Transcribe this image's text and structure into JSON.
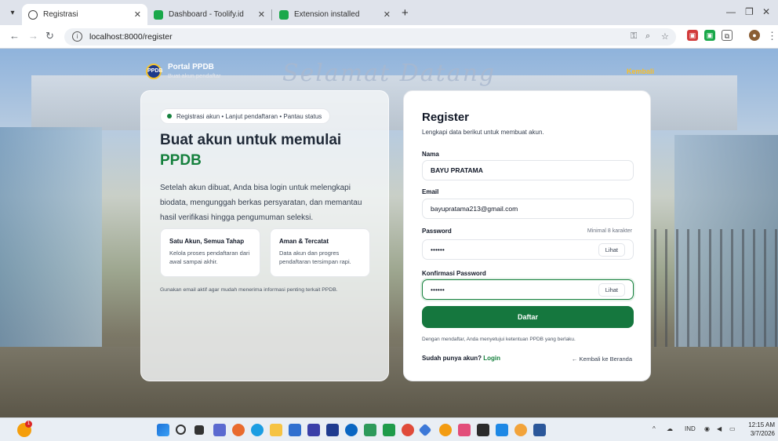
{
  "browser": {
    "tabs": [
      {
        "title": "Registrasi",
        "active": true,
        "icon": "globe-icon"
      },
      {
        "title": "Dashboard - Toolify.id",
        "active": false,
        "icon": "green-app-icon"
      },
      {
        "title": "Extension installed",
        "active": false,
        "icon": "green-app-icon"
      }
    ],
    "url": "localhost:8000/register"
  },
  "page": {
    "brand": {
      "name": "Portal PPDB",
      "subtitle": "Buat akun pendaftar"
    },
    "back_top": "Kembali",
    "background_banner": "Selamat Datang",
    "left": {
      "pill": "Registrasi akun • Lanjut pendaftaran • Pantau status",
      "hero_line1": "Buat akun untuk memulai",
      "hero_line2": "PPDB",
      "description": "Setelah akun dibuat, Anda bisa login untuk melengkapi biodata, mengunggah berkas persyaratan, dan memantau hasil verifikasi hingga pengumuman seleksi.",
      "features": [
        {
          "title": "Satu Akun, Semua Tahap",
          "desc": "Kelola proses pendaftaran dari awal sampai akhir."
        },
        {
          "title": "Aman & Tercatat",
          "desc": "Data akun dan progres pendaftaran tersimpan rapi."
        }
      ],
      "note": "Gunakan email aktif agar mudah menerima informasi penting terkait PPDB."
    },
    "form": {
      "title": "Register",
      "subtitle": "Lengkapi data berikut untuk membuat akun.",
      "name_label": "Nama",
      "name_value": "BAYU PRATAMA",
      "email_label": "Email",
      "email_value": "bayupratama213@gmail.com",
      "password_label": "Password",
      "password_hint": "Minimal 8 karakter",
      "password_value": "••••••",
      "confirm_label": "Konfirmasi Password",
      "confirm_value": "••••••",
      "show_label": "Lihat",
      "submit_label": "Daftar",
      "terms": "Dengan mendaftar, Anda menyetujui ketentuan PPDB yang berlaku.",
      "have_account": "Sudah punya akun?",
      "login_link": "Login",
      "back_home": "← Kembali ke Beranda"
    }
  },
  "taskbar": {
    "tray_lang": "IND",
    "time": "12:15 AM",
    "date": "3/7/2026",
    "weather_badge": "1"
  },
  "colors": {
    "accent": "#15803d",
    "button": "#15773e"
  }
}
